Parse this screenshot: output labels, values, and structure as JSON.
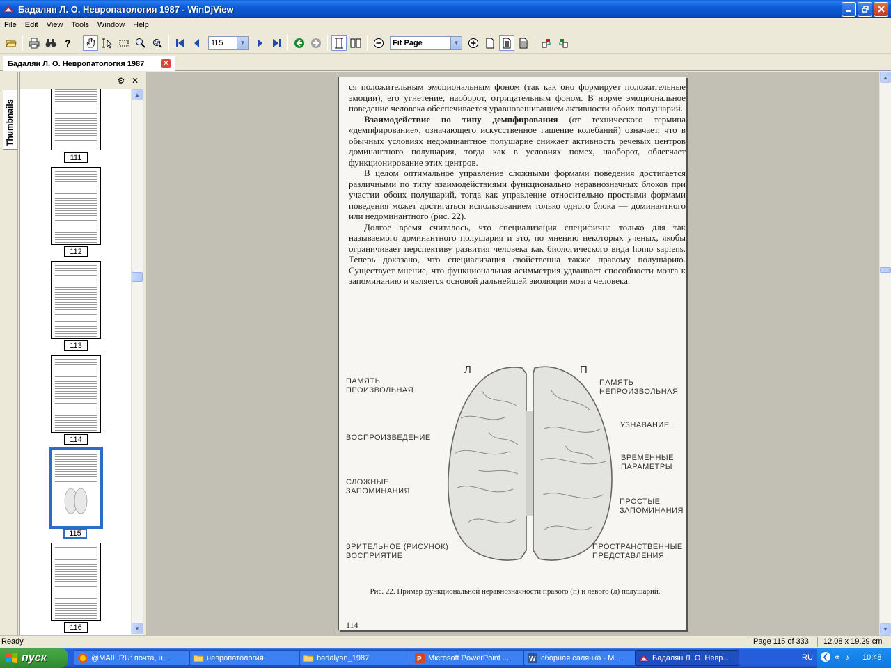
{
  "window": {
    "title": "Бадалян Л. О. Невропатология 1987 - WinDjView"
  },
  "menu": [
    "File",
    "Edit",
    "View",
    "Tools",
    "Window",
    "Help"
  ],
  "toolbar": {
    "page_value": "115",
    "zoom_value": "Fit Page"
  },
  "tab": {
    "label": "Бадалян Л. О. Невропатология 1987"
  },
  "sidebar": {
    "tab_label": "Thumbnails",
    "thumbnails": [
      {
        "page": "111",
        "selected": false
      },
      {
        "page": "112",
        "selected": false
      },
      {
        "page": "113",
        "selected": false
      },
      {
        "page": "114",
        "selected": false
      },
      {
        "page": "115",
        "selected": true
      },
      {
        "page": "116",
        "selected": false
      }
    ]
  },
  "page": {
    "para1": "ся положительным эмоциональным фоном (так как оно формирует положительные эмоции), его угнетение, наоборот, отрицательным фоном. В норме эмоциональное поведение человека обеспечивается уравновешиванием активности обоих полушарий.",
    "para2_bold": "Взаимодействие по типу демпфирования",
    "para2_rest": " (от технического термина «демпфирование», означающего искусственное гашение колебаний) означает, что в обычных условиях недоминантное полушарие снижает активность речевых центров доминантного полушария, тогда как в условиях помех, наоборот, облегчает функционирование этих центров.",
    "para3": "В целом оптимальное управление сложными формами поведения достигается различными по типу взаимодействиями функционально неравнозначных блоков при участии обоих полушарий, тогда как управление относительно простыми формами поведения может достигаться использованием только одного блока — доминантного или недоминантного (рис. 22).",
    "para4": "Долгое время считалось, что специализация специфична только для так называемого доминантного полушария и это, по мнению некоторых ученых, якобы ограничивает перспективу развития человека как биологического вида homo sapiens. Теперь доказано, что специализация свойственна также правому полушарию. Существует мнение, что функциональная асимметрия удваивает способности мозга к запоминанию и является основой дальнейшей эволюции мозга человека.",
    "figure": {
      "left_mark": "Л",
      "right_mark": "П",
      "left_labels": [
        "ПАМЯТЬ\nПРОИЗВОЛЬНАЯ",
        "ВОСПРОИЗВЕДЕНИЕ",
        "СЛОЖНЫЕ\nЗАПОМИНАНИЯ",
        "ЗРИТЕЛЬНОЕ (РИСУНОК)\nВОСПРИЯТИЕ"
      ],
      "right_labels": [
        "ПАМЯТЬ\nНЕПРОИЗВОЛЬНАЯ",
        "УЗНАВАНИЕ",
        "ВРЕМЕННЫЕ\nПАРАМЕТРЫ",
        "ПРОСТЫЕ\nЗАПОМИНАНИЯ",
        "ПРОСТРАНСТВЕННЫЕ\nПРЕДСТАВЛЕНИЯ"
      ]
    },
    "caption": "Рис. 22. Пример функциональной неравнозначности правого (п) и левого (л) полушарий.",
    "page_number": "114"
  },
  "status": {
    "left": "Ready",
    "page_info": "Page 115 of 333",
    "size_info": "12,08 x 19,29 cm"
  },
  "taskbar": {
    "start": "пуск",
    "items": [
      {
        "label": "@MAIL.RU: почта, н...",
        "active": false
      },
      {
        "label": "невропатология",
        "active": false
      },
      {
        "label": "badalyan_1987",
        "active": false
      },
      {
        "label": "Microsoft PowerPoint ...",
        "active": false
      },
      {
        "label": "сборная салянка - М...",
        "active": false
      },
      {
        "label": "Бадалян Л. О. Невр...",
        "active": true
      }
    ],
    "lang": "RU",
    "clock": "10:48"
  },
  "colors": {
    "titlebar": "#0a4fc4",
    "taskbar": "#245edb",
    "start": "#3c9d3c",
    "selection": "#316ac5"
  }
}
